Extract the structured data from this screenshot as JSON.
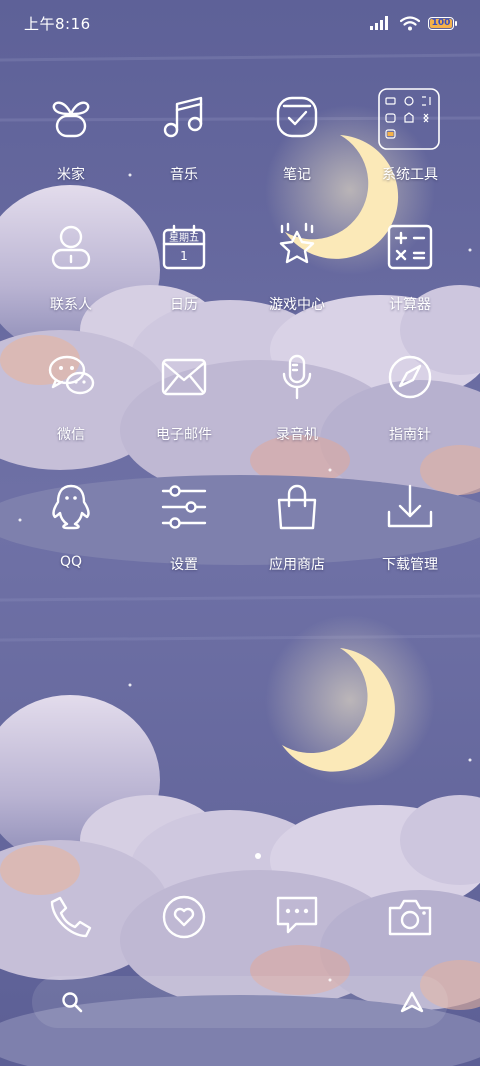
{
  "status_bar": {
    "time": "上午8:16",
    "battery": "100",
    "icons": [
      "signal-icon",
      "wifi-icon",
      "battery-icon"
    ]
  },
  "apps": {
    "mijia": "米家",
    "music": "音乐",
    "notes": "笔记",
    "system_tools": "系统工具",
    "contacts": "联系人",
    "calendar": "日历",
    "calendar_icon_day": "星期五",
    "calendar_icon_date": "1",
    "game_center": "游戏中心",
    "calculator": "计算器",
    "wechat": "微信",
    "email": "电子邮件",
    "recorder": "录音机",
    "compass": "指南针",
    "qq": "QQ",
    "settings": "设置",
    "app_store": "应用商店",
    "downloads": "下载管理"
  },
  "dock": [
    "phone-icon",
    "browser-heart-icon",
    "messages-icon",
    "camera-icon"
  ],
  "search_bar": {
    "left_icon": "search-icon",
    "right_icon": "assistant-icon"
  },
  "colors": {
    "sky": "#6f71a6",
    "cloud": "#d8d2e6",
    "cloud_warm": "#e7b7a4",
    "moon": "#fbe9b8",
    "battery_fill": "#f5b24a"
  }
}
